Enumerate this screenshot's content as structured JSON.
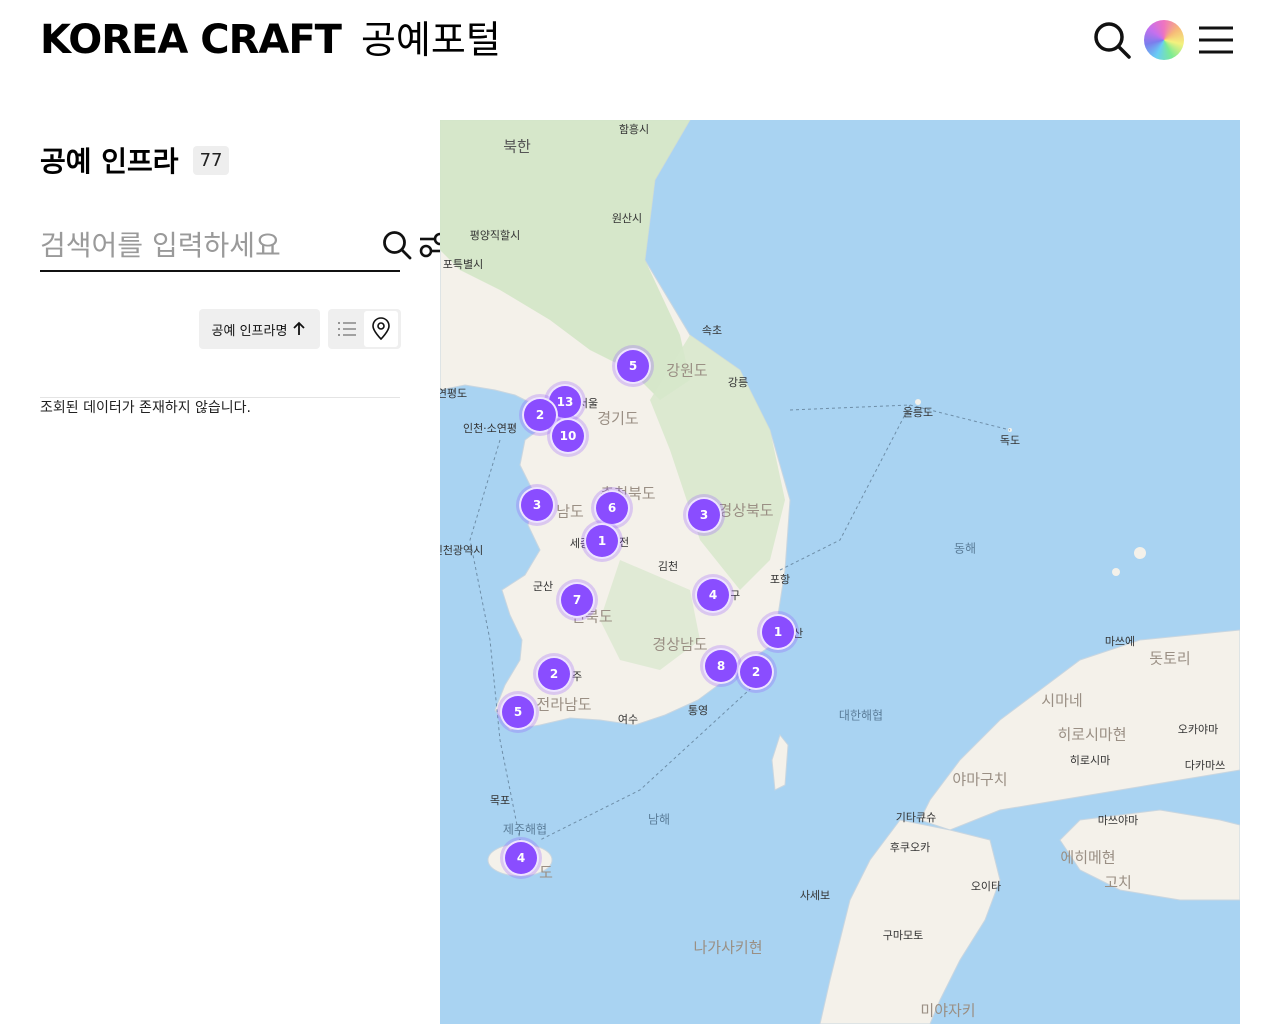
{
  "header": {
    "logo_text": "KOREA CRAFT",
    "logo_subtitle": "공예포털",
    "icons": [
      "search-icon",
      "color-wheel-icon",
      "hamburger-menu-icon"
    ]
  },
  "sidebar": {
    "title": "공예 인프라",
    "count": "77",
    "search": {
      "placeholder": "검색어를 입력하세요",
      "value": ""
    },
    "sort_label": "공예 인프라명",
    "view_modes": [
      "list-icon",
      "map-pin-icon"
    ],
    "empty_message": "조회된 데이터가 존재하지 않습니다."
  },
  "map": {
    "labels": [
      {
        "text": "함흥시"
      },
      {
        "text": "북한"
      },
      {
        "text": "원산시"
      },
      {
        "text": "평양직할시"
      },
      {
        "text": "포특별시"
      },
      {
        "text": "속초"
      },
      {
        "text": "강원도"
      },
      {
        "text": "강릉"
      },
      {
        "text": "울릉도"
      },
      {
        "text": "독도"
      },
      {
        "text": "서울"
      },
      {
        "text": "경기도"
      },
      {
        "text": "연평도"
      },
      {
        "text": "인천·소연평"
      },
      {
        "text": "충청북도"
      },
      {
        "text": "남도"
      },
      {
        "text": "경상북도"
      },
      {
        "text": "세종"
      },
      {
        "text": "전"
      },
      {
        "text": "김천"
      },
      {
        "text": "포항"
      },
      {
        "text": "구"
      },
      {
        "text": "군산"
      },
      {
        "text": "전북도"
      },
      {
        "text": "경상남도"
      },
      {
        "text": "산"
      },
      {
        "text": "주"
      },
      {
        "text": "전라남도"
      },
      {
        "text": "여수"
      },
      {
        "text": "통영"
      },
      {
        "text": "대한해협"
      },
      {
        "text": "제주해협"
      },
      {
        "text": "도"
      },
      {
        "text": "남해"
      },
      {
        "text": "동해"
      },
      {
        "text": "마쓰에"
      },
      {
        "text": "돗토리"
      },
      {
        "text": "시마네"
      },
      {
        "text": "히로시마현"
      },
      {
        "text": "오카야마"
      },
      {
        "text": "히로시마"
      },
      {
        "text": "다카마쓰"
      },
      {
        "text": "야마구치"
      },
      {
        "text": "기타큐슈"
      },
      {
        "text": "후쿠오카"
      },
      {
        "text": "마쓰야마"
      },
      {
        "text": "에히메현"
      },
      {
        "text": "고치"
      },
      {
        "text": "오이타"
      },
      {
        "text": "사세보"
      },
      {
        "text": "구마모토"
      },
      {
        "text": "나가사키현"
      },
      {
        "text": "미야자키"
      },
      {
        "text": "인천광역시"
      },
      {
        "text": "목포"
      }
    ],
    "clusters": [
      {
        "count": "5"
      },
      {
        "count": "13"
      },
      {
        "count": "2"
      },
      {
        "count": "10"
      },
      {
        "count": "3"
      },
      {
        "count": "6"
      },
      {
        "count": "3"
      },
      {
        "count": "1"
      },
      {
        "count": "7"
      },
      {
        "count": "4"
      },
      {
        "count": "1"
      },
      {
        "count": "8"
      },
      {
        "count": "2"
      },
      {
        "count": "2"
      },
      {
        "count": "5"
      },
      {
        "count": "4"
      }
    ]
  },
  "colors": {
    "cluster": "#8a4dff",
    "sea": "#a9d3f2",
    "land": "#f4f1ea",
    "mountain": "#cfe2c2"
  }
}
